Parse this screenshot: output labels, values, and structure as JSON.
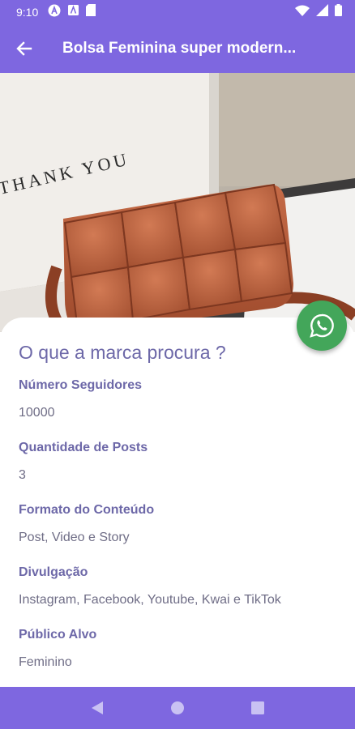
{
  "status_bar": {
    "time": "9:10",
    "icons_left": [
      "a-circle-icon",
      "a-square-icon",
      "sd-card-icon"
    ],
    "icons_right": [
      "wifi-icon",
      "signal-icon",
      "battery-icon"
    ]
  },
  "app_bar": {
    "title": "Bolsa Feminina super modern...",
    "back_icon": "arrow-left-icon"
  },
  "hero_image": {
    "box_text": "THANK YOU"
  },
  "card": {
    "title": "O que a marca procura ?",
    "fields": [
      {
        "label": "Número Seguidores",
        "value": "10000"
      },
      {
        "label": "Quantidade de Posts",
        "value": "3"
      },
      {
        "label": "Formato do Conteúdo",
        "value": "Post, Video e Story"
      },
      {
        "label": "Divulgação",
        "value": "Instagram, Facebook, Youtube, Kwai e TikTok"
      },
      {
        "label": "Público Alvo",
        "value": "Feminino"
      }
    ]
  },
  "fab": {
    "icon": "whatsapp-icon"
  },
  "nav_bar": {
    "buttons": [
      "back-triangle-icon",
      "home-circle-icon",
      "recents-square-icon"
    ]
  },
  "colors": {
    "primary": "#7e67e0",
    "text_purple": "#6d68a8",
    "whatsapp": "#43a65a"
  }
}
